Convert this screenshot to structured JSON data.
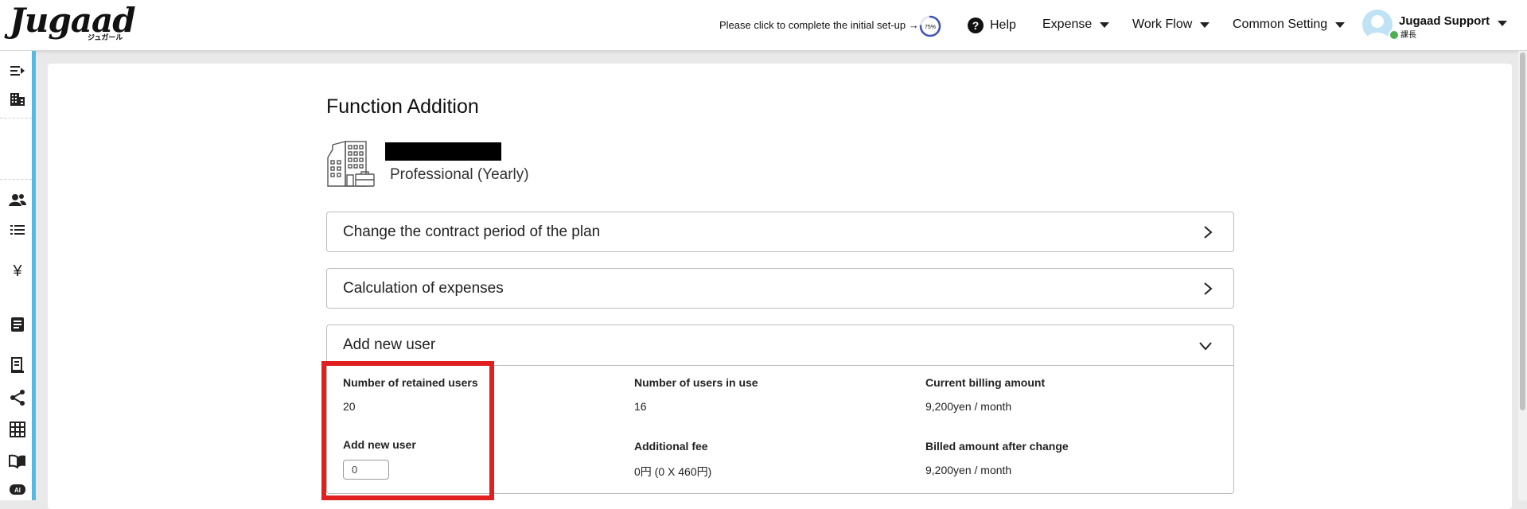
{
  "header": {
    "logo_text": "Jugaad",
    "logo_sub": "ジュガール",
    "setup_prompt": "Please click to complete the initial set-up →",
    "setup_progress_label": "75%",
    "setup_progress_fraction": 0.75,
    "help_label": "Help",
    "nav": [
      {
        "label": "Expense"
      },
      {
        "label": "Work Flow"
      },
      {
        "label": "Common Setting"
      }
    ],
    "user": {
      "name": "Jugaad Support",
      "role": "課長",
      "status_color": "#4caf50"
    }
  },
  "sidebar": {
    "accent_color": "#57b8e6",
    "icons": [
      "collapse-menu-icon",
      "company-icon",
      "users-icon",
      "list-icon",
      "yen-icon",
      "document-icon",
      "receipt-icon",
      "share-icon",
      "grid-icon",
      "manual-book-icon",
      "ai-icon"
    ]
  },
  "main": {
    "title": "Function Addition",
    "plan": "Professional (Yearly)",
    "sections": [
      {
        "label": "Change the contract period of the plan",
        "expanded": false
      },
      {
        "label": "Calculation of expenses",
        "expanded": false
      },
      {
        "label": "Add new user",
        "expanded": true
      }
    ],
    "add_user": {
      "retained_label": "Number of retained users",
      "retained_value": "20",
      "in_use_label": "Number of users in use",
      "in_use_value": "16",
      "current_billing_label": "Current billing amount",
      "current_billing_value": "9,200yen / month",
      "add_label": "Add new user",
      "add_value": "0",
      "fee_label": "Additional fee",
      "fee_value": "0円 (0 X 460円)",
      "after_label": "Billed amount after change",
      "after_value": "9,200yen / month"
    }
  },
  "colors": {
    "highlight": "#e02020",
    "progress": "#3f51b5"
  }
}
